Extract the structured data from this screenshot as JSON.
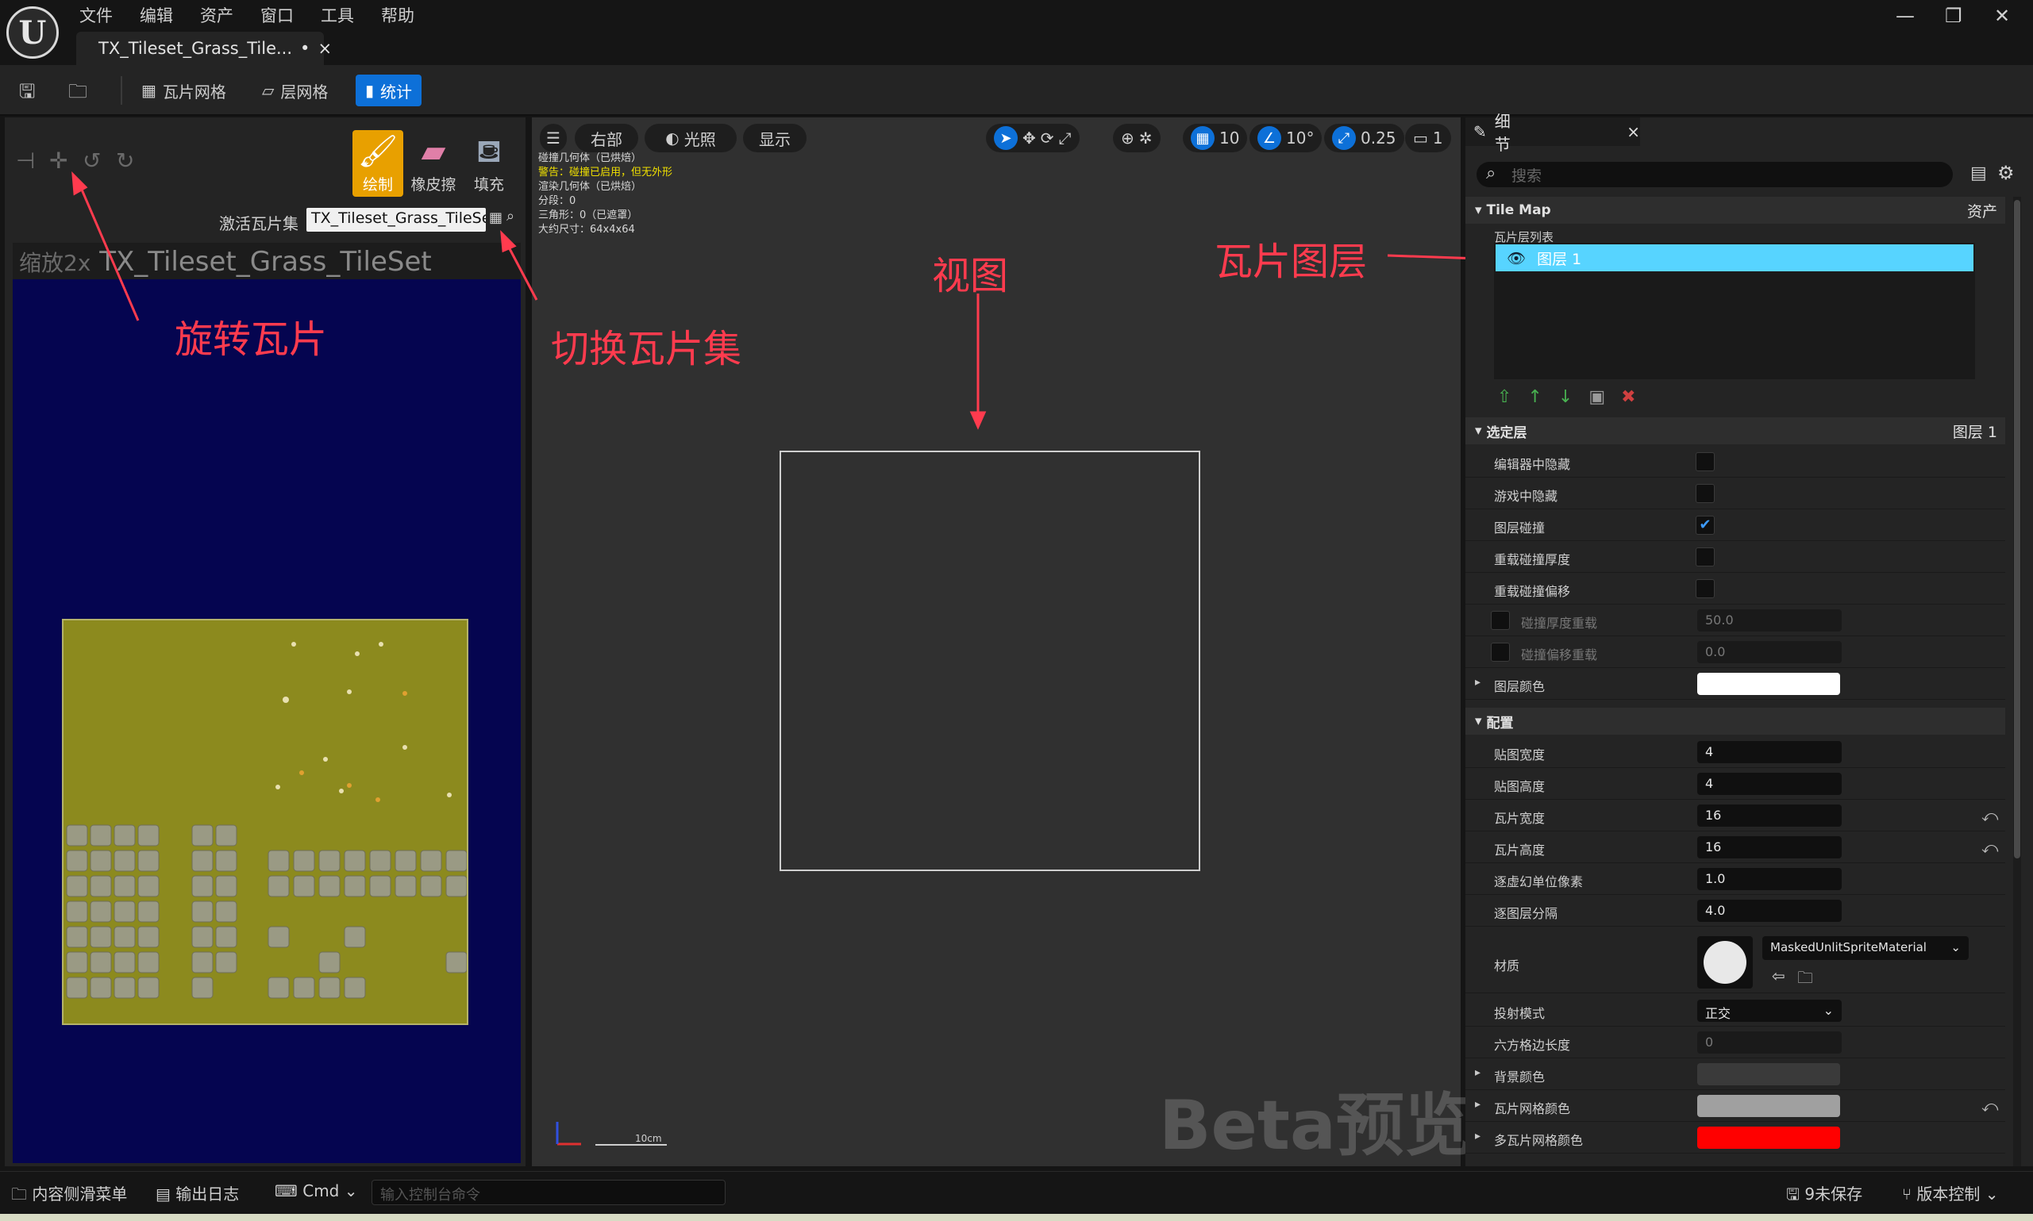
{
  "menu": [
    "文件",
    "编辑",
    "资产",
    "窗口",
    "工具",
    "帮助"
  ],
  "document_tab": {
    "title": "TX_Tileset_Grass_Tile...",
    "dirty_mark": "•",
    "close": "×"
  },
  "window_buttons": {
    "minimize": "—",
    "restore": "❐",
    "close": "✕"
  },
  "toolbar": {
    "tile_grid": "瓦片网格",
    "layer_grid": "层网格",
    "stats": "统计"
  },
  "tools": {
    "draw": "绘制",
    "eraser": "橡皮擦",
    "fill": "填充"
  },
  "tileset": {
    "active_label": "激活瓦片集",
    "active_value": "TX_Tileset_Grass_TileSet",
    "zoom_prefix": "缩放2x",
    "view_title": "TX_Tileset_Grass_TileSet"
  },
  "viewport": {
    "view_mode": "右部",
    "lighting": "光照",
    "show": "显示",
    "grid_snap": "10",
    "rot_snap": "10°",
    "scale_snap": "0.25",
    "camera_speed": "1",
    "stats": [
      {
        "text": "碰撞几何体（已烘焙）",
        "warn": false
      },
      {
        "text": "警告：碰撞已启用，但无外形",
        "warn": true
      },
      {
        "text": "渲染几何体（已烘焙）",
        "warn": false
      },
      {
        "text": "分段：0",
        "warn": false
      },
      {
        "text": "三角形：0（已遮罩）",
        "warn": false
      },
      {
        "text": "大约尺寸：64x4x64",
        "warn": false
      }
    ],
    "watermark": "Beta预览",
    "scale_label": "10cm"
  },
  "annotations": {
    "rotate": "旋转瓦片",
    "switch_tileset": "切换瓦片集",
    "view": "视图",
    "tile_layer": "瓦片图层"
  },
  "details": {
    "tab_title": "细节",
    "search_placeholder": "搜索",
    "tilemap_section": "Tile Map",
    "tilemap_right": "资产",
    "layer_list_label": "瓦片层列表",
    "layer_item": "图层 1",
    "selected_section": "选定层",
    "selected_right": "图层 1",
    "config_section": "配置",
    "material_value": "MaskedUnlitSpriteMaterial",
    "projection_value": "正交"
  },
  "selected_layer_props": [
    {
      "label": "编辑器中隐藏",
      "type": "check",
      "checked": false
    },
    {
      "label": "游戏中隐藏",
      "type": "check",
      "checked": false
    },
    {
      "label": "图层碰撞",
      "type": "check",
      "checked": true
    },
    {
      "label": "重载碰撞厚度",
      "type": "check",
      "checked": false
    },
    {
      "label": "重载碰撞偏移",
      "type": "check",
      "checked": false
    },
    {
      "label": "碰撞厚度重载",
      "type": "dimfield",
      "value": "50.0"
    },
    {
      "label": "碰撞偏移重载",
      "type": "dimfield",
      "value": "0.0"
    },
    {
      "label": "图层颜色",
      "type": "color",
      "color": "#ffffff"
    }
  ],
  "config_props": [
    {
      "label": "贴图宽度",
      "value": "4",
      "reset": false
    },
    {
      "label": "贴图高度",
      "value": "4",
      "reset": false
    },
    {
      "label": "瓦片宽度",
      "value": "16",
      "reset": true
    },
    {
      "label": "瓦片高度",
      "value": "16",
      "reset": true
    },
    {
      "label": "逐虚幻单位像素",
      "value": "1.0",
      "reset": false
    },
    {
      "label": "逐图层分隔",
      "value": "4.0",
      "reset": false
    }
  ],
  "config_props2": [
    {
      "label": "材质"
    },
    {
      "label": "投射模式"
    },
    {
      "label": "六方格边长度",
      "value": "0"
    },
    {
      "label": "背景颜色",
      "color": "#3a3a3a"
    },
    {
      "label": "瓦片网格颜色",
      "color": "#a0a0a0"
    },
    {
      "label": "多瓦片网格颜色",
      "color": "#ff0000"
    }
  ],
  "statusbar": {
    "content_drawer": "内容侧滑菜单",
    "output_log": "输出日志",
    "cmd": "Cmd",
    "console_placeholder": "输入控制台命令",
    "unsaved": "9未保存",
    "source_control": "版本控制"
  },
  "colors": {
    "accent": "#0d70d8",
    "draw_tool": "#e8a000",
    "annotation": "#ff3b4e",
    "layer_highlight": "#57d4ff"
  }
}
